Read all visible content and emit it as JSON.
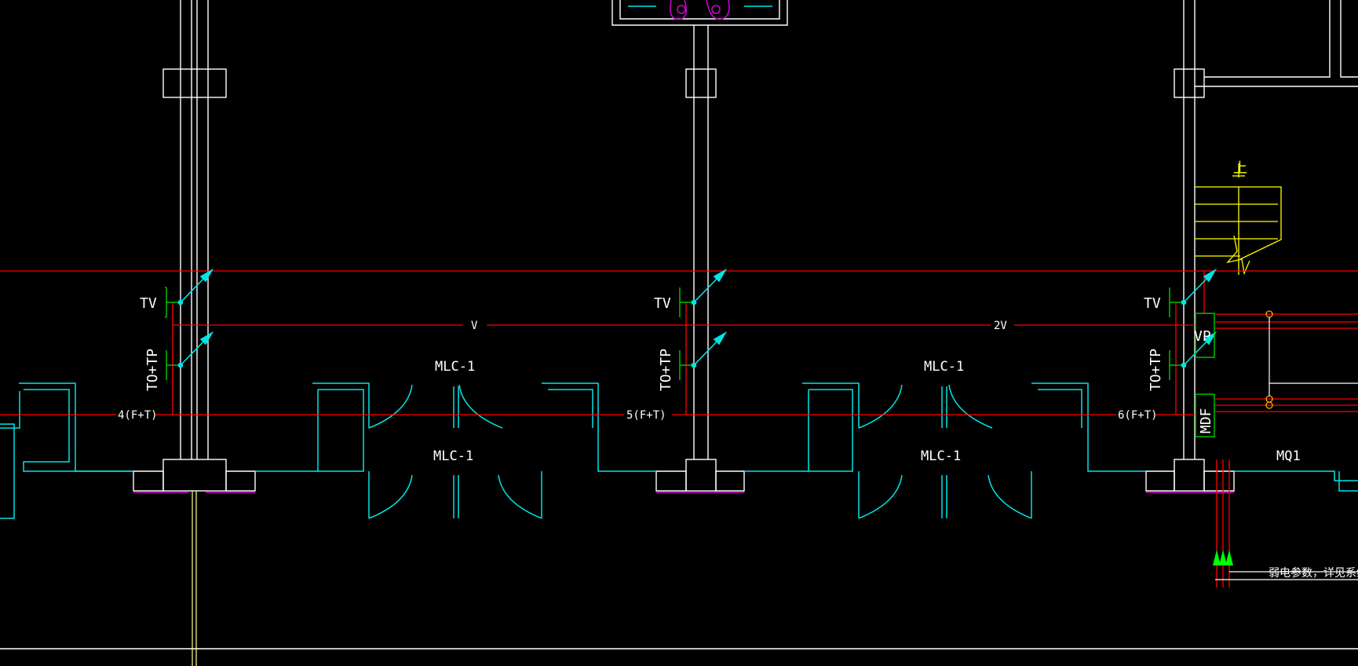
{
  "drawing": {
    "background": "#000000",
    "colors": {
      "wall": "#ffffff",
      "door": "#00e5e5",
      "cable": "#ff0000",
      "outlet": "#00c000",
      "arrow": "#00e5e5",
      "stair": "#ffff00",
      "window_sill": "#cc00cc",
      "pipe": "#ffff88",
      "ground_symbol": "#00ff00"
    },
    "labels": {
      "tv": "TV",
      "to_tp": "TO+TP",
      "vp": "VP",
      "mdf": "MDF",
      "stair_up": "上",
      "cable_v": "V",
      "cable_2v": "2V",
      "door_type": "MLC-1",
      "room_window": "MQ1",
      "branch_1": "4(F+T)",
      "branch_2": "5(F+T)",
      "branch_3": "6(F+T)",
      "note": "弱电参数，详见系统"
    },
    "icons": [
      "tv-outlet-icon",
      "data-outlet-icon",
      "cable-arrow-icon",
      "ground-symbol-icon",
      "distribution-box-icon"
    ]
  }
}
